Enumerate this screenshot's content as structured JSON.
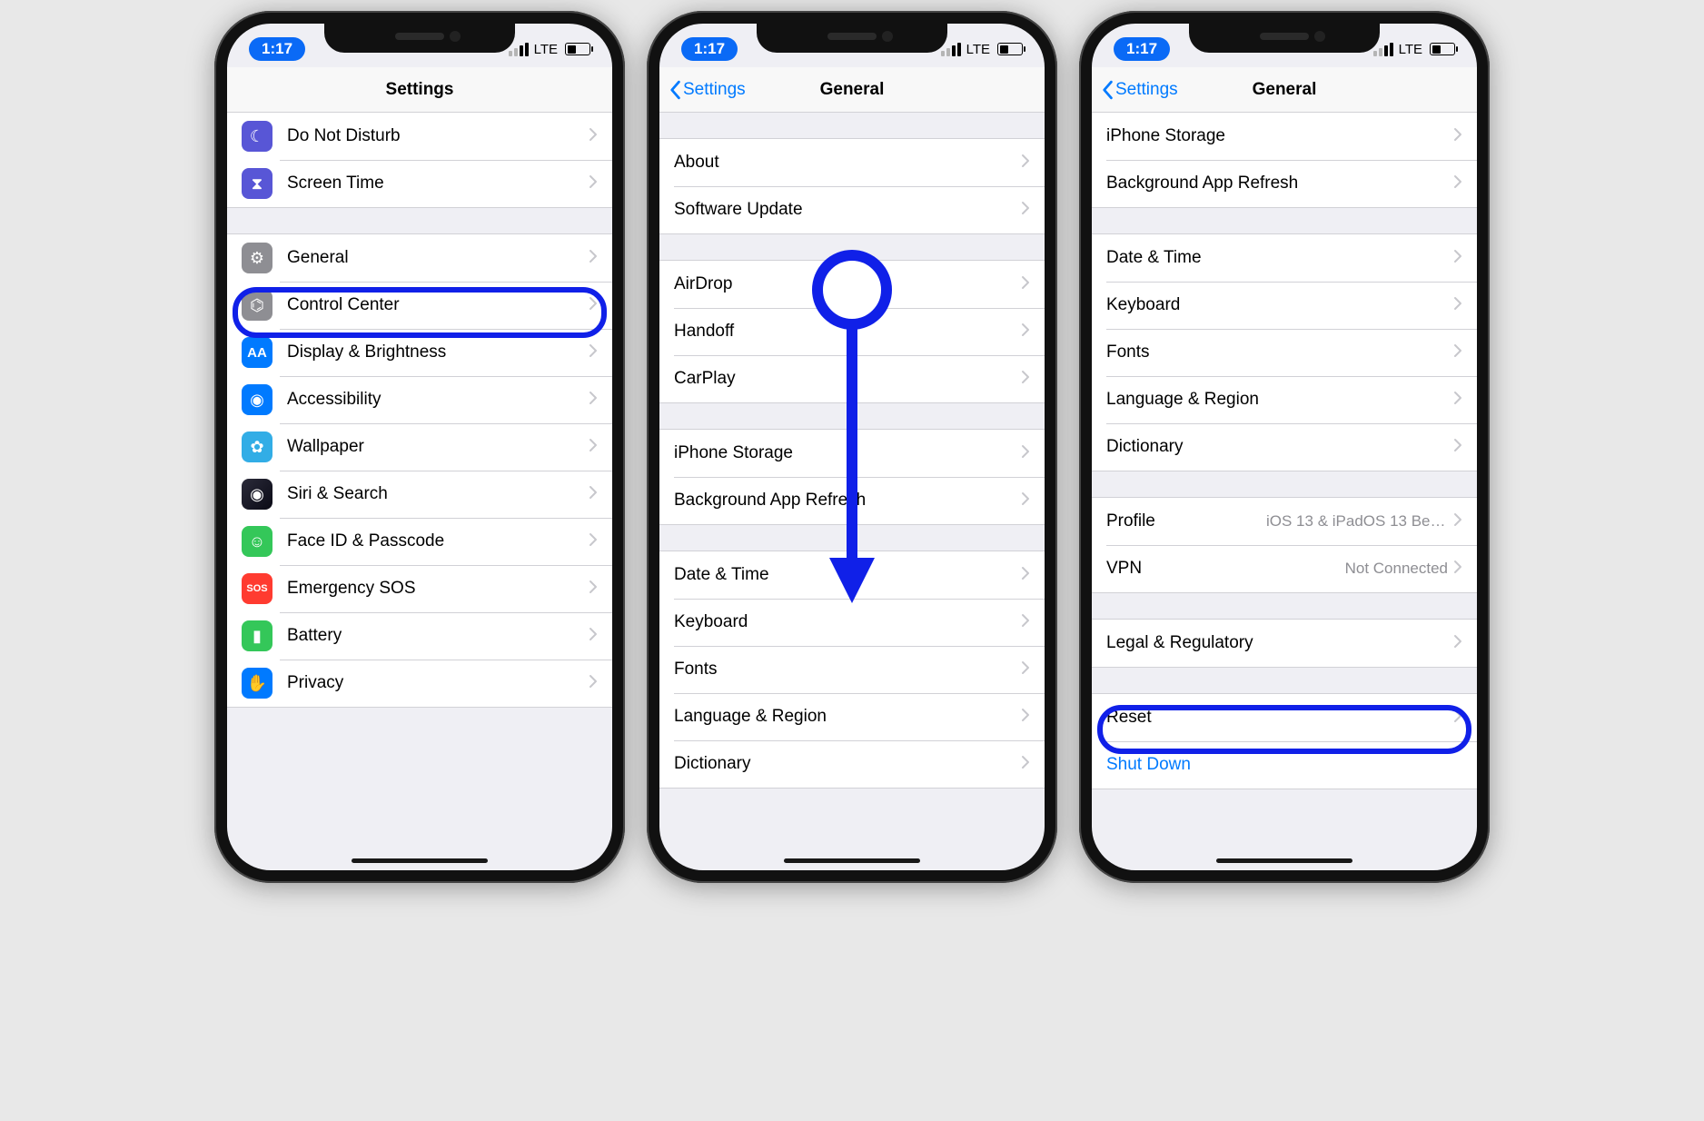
{
  "status": {
    "time": "1:17",
    "carrier": "LTE"
  },
  "screen1": {
    "title": "Settings",
    "groups": [
      [
        {
          "label": "Do Not Disturb",
          "icon": "moon-icon",
          "bg": "bg-purple"
        },
        {
          "label": "Screen Time",
          "icon": "hourglass-icon",
          "bg": "bg-purple2"
        }
      ],
      [
        {
          "label": "General",
          "icon": "gear-icon",
          "bg": "bg-gray",
          "highlight": true
        },
        {
          "label": "Control Center",
          "icon": "toggles-icon",
          "bg": "bg-gray2"
        },
        {
          "label": "Display & Brightness",
          "icon": "text-size-icon",
          "bg": "bg-blue"
        },
        {
          "label": "Accessibility",
          "icon": "accessibility-icon",
          "bg": "bg-blue"
        },
        {
          "label": "Wallpaper",
          "icon": "flower-icon",
          "bg": "bg-cyan"
        },
        {
          "label": "Siri & Search",
          "icon": "siri-icon",
          "bg": "bg-siri"
        },
        {
          "label": "Face ID & Passcode",
          "icon": "faceid-icon",
          "bg": "bg-green"
        },
        {
          "label": "Emergency SOS",
          "icon": "sos-icon",
          "bg": "bg-red"
        },
        {
          "label": "Battery",
          "icon": "battery-icon",
          "bg": "bg-green"
        },
        {
          "label": "Privacy",
          "icon": "hand-icon",
          "bg": "bg-blue"
        }
      ]
    ]
  },
  "screen2": {
    "back": "Settings",
    "title": "General",
    "groups": [
      [
        {
          "label": "About"
        },
        {
          "label": "Software Update"
        }
      ],
      [
        {
          "label": "AirDrop"
        },
        {
          "label": "Handoff"
        },
        {
          "label": "CarPlay"
        }
      ],
      [
        {
          "label": "iPhone Storage"
        },
        {
          "label": "Background App Refresh"
        }
      ],
      [
        {
          "label": "Date & Time"
        },
        {
          "label": "Keyboard"
        },
        {
          "label": "Fonts"
        },
        {
          "label": "Language & Region"
        },
        {
          "label": "Dictionary"
        }
      ]
    ]
  },
  "screen3": {
    "back": "Settings",
    "title": "General",
    "groups": [
      [
        {
          "label": "iPhone Storage"
        },
        {
          "label": "Background App Refresh"
        }
      ],
      [
        {
          "label": "Date & Time"
        },
        {
          "label": "Keyboard"
        },
        {
          "label": "Fonts"
        },
        {
          "label": "Language & Region"
        },
        {
          "label": "Dictionary"
        }
      ],
      [
        {
          "key": "Profile",
          "detail": "iOS 13 & iPadOS 13 Beta Softwar..."
        },
        {
          "key": "VPN",
          "detail": "Not Connected"
        }
      ],
      [
        {
          "label": "Legal & Regulatory"
        }
      ],
      [
        {
          "label": "Reset",
          "highlight": true
        },
        {
          "label": "Shut Down",
          "blue": true,
          "noChevron": true
        }
      ]
    ]
  }
}
